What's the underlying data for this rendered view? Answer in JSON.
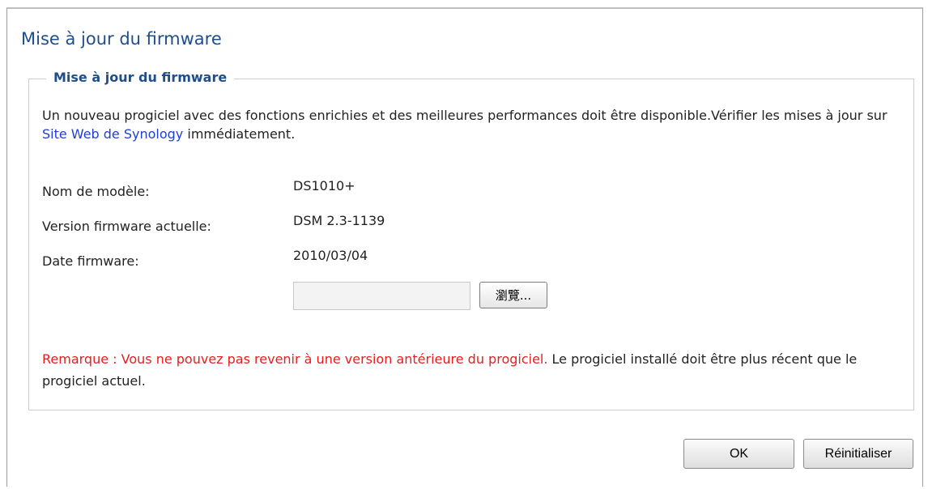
{
  "window": {
    "title": "Mise à jour du firmware"
  },
  "section": {
    "legend": "Mise à jour du firmware",
    "description": {
      "text_before_link": "Un nouveau progiciel avec des fonctions enrichies et des meilleures performances doit être disponible.Vérifier les mises à jour sur ",
      "link_text": "Site Web de Synology",
      "text_after_link": " immédiatement."
    },
    "fields": {
      "model_label": "Nom de modèle:",
      "model_value": "DS1010+",
      "version_label": "Version firmware actuelle:",
      "version_value": "DSM 2.3-1139",
      "date_label": "Date firmware:",
      "date_value": "2010/03/04"
    },
    "file_upload": {
      "value": "",
      "browse_label": "瀏覽..."
    },
    "note": {
      "warning": "Remarque : Vous ne pouvez pas revenir à une version antérieure du progiciel.",
      "text": " Le progiciel installé doit être plus récent que le progiciel actuel."
    }
  },
  "footer": {
    "ok_label": "OK",
    "reset_label": "Réinitialiser"
  },
  "colors": {
    "title": "#1f4e8a",
    "link": "#1f3fd6",
    "warning": "#ea1c1c",
    "border": "#c9cdd2"
  }
}
